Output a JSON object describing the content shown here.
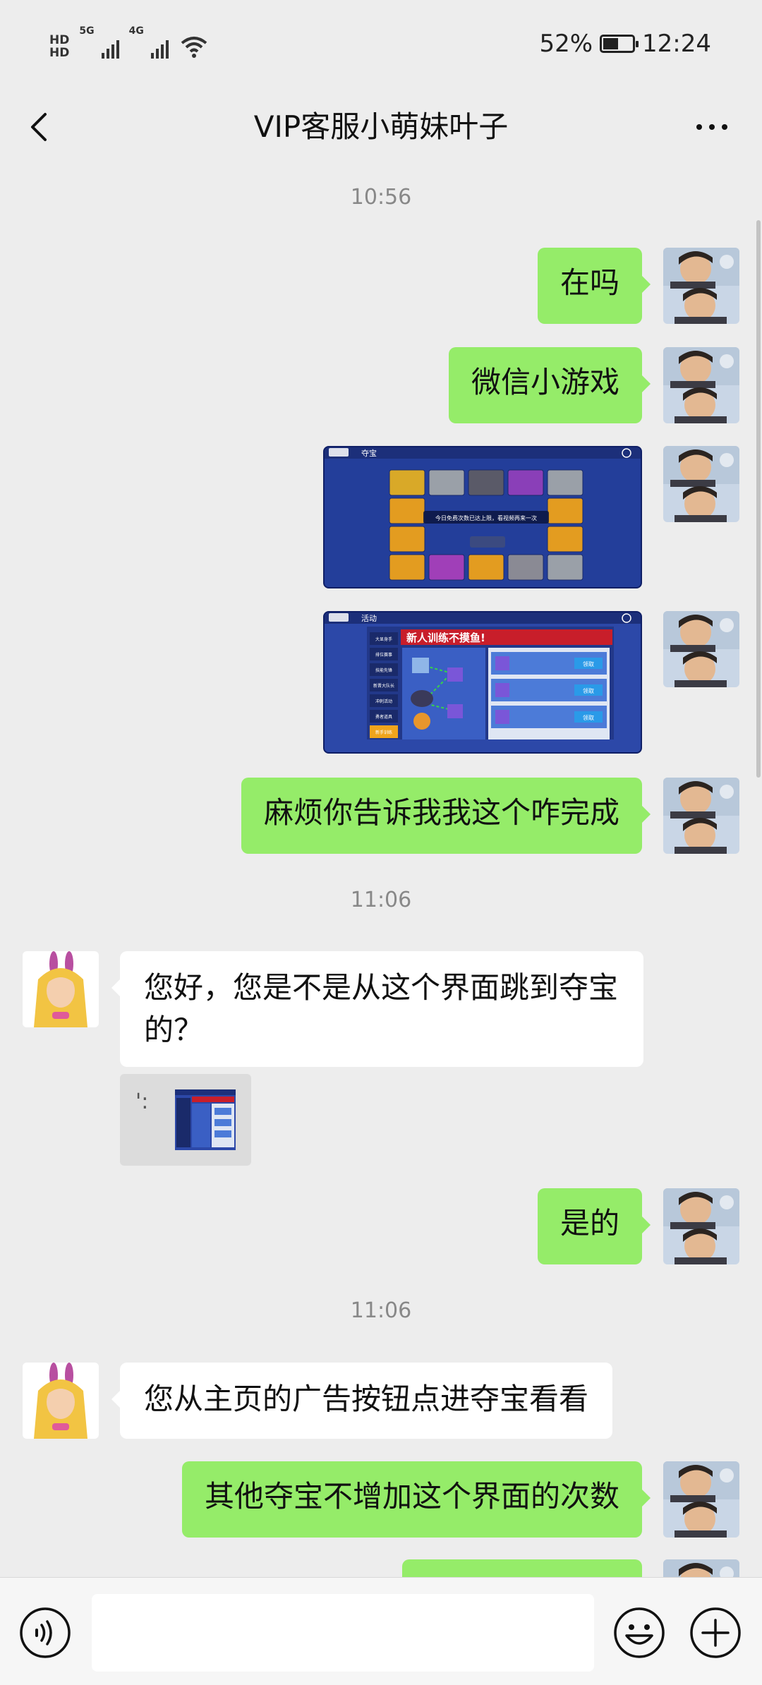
{
  "status_bar": {
    "hd1": "HD",
    "hd2": "HD",
    "net1": "5G",
    "net2": "4G",
    "battery_text": "52%",
    "battery_level": 0.52,
    "time": "12:24"
  },
  "nav": {
    "title": "VIP客服小萌妹叶子",
    "back_icon": "chevron-left-icon",
    "more_icon": "more-dots-icon"
  },
  "messages": {
    "t1": "10:56",
    "m1": "在吗",
    "m2": "微信小游戏",
    "m5": "麻烦你告诉我我这个咋完成",
    "t2": "11:06",
    "r1": "您好，您是不是从这个界面跳到夺宝的？",
    "r1_quote_prefix": "':",
    "m6": "是的",
    "t3": "11:06",
    "r2": "您从主页的广告按钮点进夺宝看看",
    "m7": "其他夺宝不增加这个界面的次数"
  },
  "game_screens": {
    "screen1_tab": "夺宝",
    "screen1_popup": "今日免费次数已达上限，看视频再来一次",
    "screen2_tab": "活动",
    "screen2_banner": "新人训练不摸鱼!",
    "screen2_menu": [
      "大显身手",
      "排位赛事",
      "技能先锋",
      "新晋大队长",
      "冲刺活动",
      "勇者道具",
      "新手训练"
    ],
    "screen2_btn": "领取"
  },
  "input_bar": {
    "value": "",
    "voice_icon": "voice-icon",
    "emoji_icon": "emoji-icon",
    "plus_icon": "plus-icon"
  },
  "colors": {
    "background": "#ededed",
    "my_bubble": "#95ec69",
    "their_bubble": "#ffffff"
  }
}
